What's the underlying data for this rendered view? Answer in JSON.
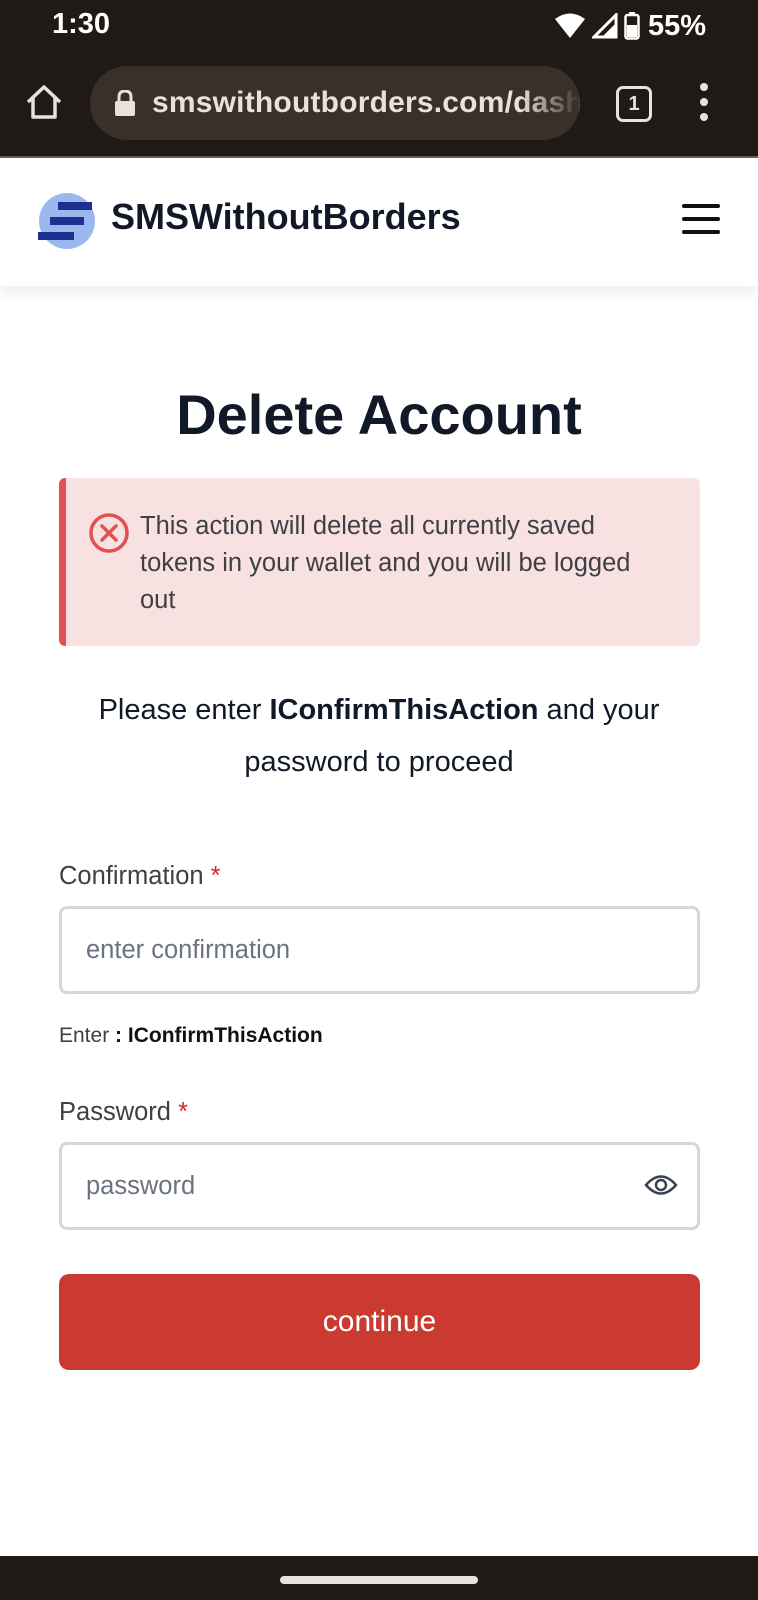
{
  "status_bar": {
    "time": "1:30",
    "battery": "55%"
  },
  "browser": {
    "url": "smswithoutborders.com/dashboard",
    "tab_count": "1"
  },
  "site": {
    "brand": "SMSWithoutBorders"
  },
  "page": {
    "title": "Delete Account",
    "alert": "This action will delete all currently saved tokens in your wallet and you will be logged out",
    "instruction_prefix": "Please enter ",
    "instruction_keyword": "IConfirmThisAction",
    "instruction_suffix": " and your password to proceed"
  },
  "form": {
    "confirmation_label": "Confirmation",
    "confirmation_placeholder": "enter confirmation",
    "hint_prefix": "Enter",
    "hint_sep": " : ",
    "hint_value": "IConfirmThisAction",
    "password_label": "Password",
    "password_placeholder": "password",
    "required_mark": "*",
    "submit_label": "continue"
  },
  "colors": {
    "accent_red": "#cb3a30",
    "alert_bg": "#f8e1e1",
    "brand_blue": "#1e3a8a"
  }
}
